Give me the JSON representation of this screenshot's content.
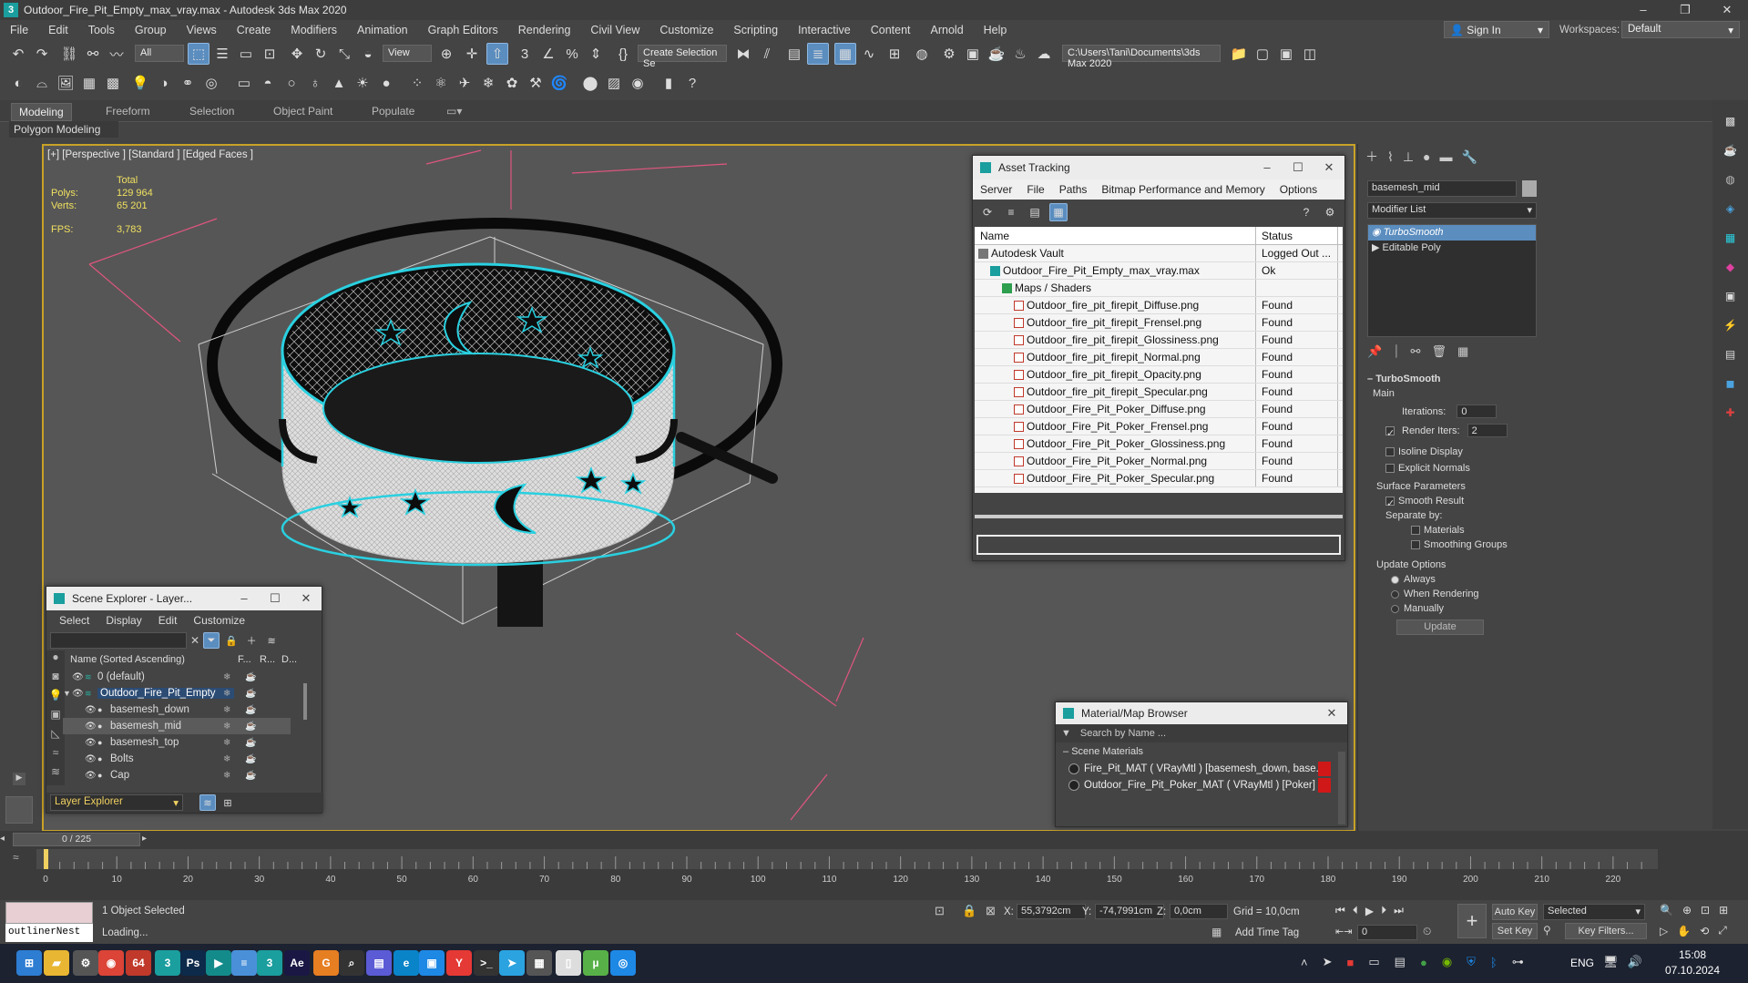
{
  "app": {
    "icon_label": "3",
    "title": "Outdoor_Fire_Pit_Empty_max_vray.max - Autodesk 3ds Max 2020",
    "window_buttons": [
      "–",
      "❐",
      "✕"
    ]
  },
  "menu": [
    "File",
    "Edit",
    "Tools",
    "Group",
    "Views",
    "Create",
    "Modifiers",
    "Animation",
    "Graph Editors",
    "Rendering",
    "Civil View",
    "Customize",
    "Scripting",
    "Interactive",
    "Content",
    "Arnold",
    "Help"
  ],
  "signin": {
    "label": "Sign In"
  },
  "workspaces": {
    "label": "Workspaces:",
    "value": "Default"
  },
  "toolbar": {
    "selection_filter": "All",
    "view_dropdown": "View",
    "create_selection_set": "Create Selection Se",
    "project_path": "C:\\Users\\Tani\\Documents\\3ds Max 2020"
  },
  "ribbon": {
    "tabs": [
      "Modeling",
      "Freeform",
      "Selection",
      "Object Paint",
      "Populate"
    ],
    "sub_label": "Polygon Modeling"
  },
  "viewport": {
    "label": "[+] [Perspective ] [Standard ] [Edged Faces ]",
    "stats": {
      "total_label": "Total",
      "polys_label": "Polys:",
      "polys_value": "129 964",
      "verts_label": "Verts:",
      "verts_value": "65 201",
      "fps_label": "FPS:",
      "fps_value": "3,783"
    }
  },
  "asset_tracking": {
    "title": "Asset Tracking",
    "menu": [
      "Server",
      "File",
      "Paths",
      "Bitmap Performance and Memory",
      "Options"
    ],
    "columns": [
      "Name",
      "Status"
    ],
    "rows": [
      {
        "name": "Autodesk Vault",
        "status": "Logged Out ...",
        "indent": 0,
        "icon": "vault-icon"
      },
      {
        "name": "Outdoor_Fire_Pit_Empty_max_vray.max",
        "status": "Ok",
        "indent": 1,
        "icon": "max-file-icon"
      },
      {
        "name": "Maps / Shaders",
        "status": "",
        "indent": 2,
        "icon": "maps-icon"
      },
      {
        "name": "Outdoor_fire_pit_firepit_Diffuse.png",
        "status": "Found",
        "indent": 3,
        "icon": "png-icon"
      },
      {
        "name": "Outdoor_fire_pit_firepit_Frensel.png",
        "status": "Found",
        "indent": 3,
        "icon": "png-icon"
      },
      {
        "name": "Outdoor_fire_pit_firepit_Glossiness.png",
        "status": "Found",
        "indent": 3,
        "icon": "png-icon"
      },
      {
        "name": "Outdoor_fire_pit_firepit_Normal.png",
        "status": "Found",
        "indent": 3,
        "icon": "png-icon"
      },
      {
        "name": "Outdoor_fire_pit_firepit_Opacity.png",
        "status": "Found",
        "indent": 3,
        "icon": "png-icon"
      },
      {
        "name": "Outdoor_fire_pit_firepit_Specular.png",
        "status": "Found",
        "indent": 3,
        "icon": "png-icon"
      },
      {
        "name": "Outdoor_Fire_Pit_Poker_Diffuse.png",
        "status": "Found",
        "indent": 3,
        "icon": "png-icon"
      },
      {
        "name": "Outdoor_Fire_Pit_Poker_Frensel.png",
        "status": "Found",
        "indent": 3,
        "icon": "png-icon"
      },
      {
        "name": "Outdoor_Fire_Pit_Poker_Glossiness.png",
        "status": "Found",
        "indent": 3,
        "icon": "png-icon"
      },
      {
        "name": "Outdoor_Fire_Pit_Poker_Normal.png",
        "status": "Found",
        "indent": 3,
        "icon": "png-icon"
      },
      {
        "name": "Outdoor_Fire_Pit_Poker_Specular.png",
        "status": "Found",
        "indent": 3,
        "icon": "png-icon"
      }
    ]
  },
  "scene_explorer": {
    "title": "Scene Explorer - Layer...",
    "menu": [
      "Select",
      "Display",
      "Edit",
      "Customize"
    ],
    "columns": [
      "Name (Sorted Ascending)",
      "F...",
      "R...",
      "D..."
    ],
    "rows": [
      {
        "name": "0 (default)",
        "indent": 1,
        "selected": false
      },
      {
        "name": "Outdoor_Fire_Pit_Empty",
        "indent": 1,
        "selected": false,
        "highlight": true
      },
      {
        "name": "basemesh_down",
        "indent": 2,
        "selected": false
      },
      {
        "name": "basemesh_mid",
        "indent": 2,
        "selected": true
      },
      {
        "name": "basemesh_top",
        "indent": 2,
        "selected": false
      },
      {
        "name": "Bolts",
        "indent": 2,
        "selected": false
      },
      {
        "name": "Cap",
        "indent": 2,
        "selected": false
      }
    ],
    "footer": "Layer Explorer"
  },
  "material_browser": {
    "title": "Material/Map Browser",
    "search_placeholder": "Search by Name ...",
    "section": "Scene Materials",
    "items": [
      "Fire_Pit_MAT ( VRayMtl ) [basemesh_down, base...",
      "Outdoor_Fire_Pit_Poker_MAT ( VRayMtl ) [Poker]"
    ]
  },
  "command_panel": {
    "object_name": "basemesh_mid",
    "modifier_list": "Modifier List",
    "stack": [
      "TurboSmooth",
      "Editable Poly"
    ],
    "rollout_title": "TurboSmooth",
    "main_label": "Main",
    "iterations_label": "Iterations:",
    "iterations_value": "0",
    "render_iters_label": "Render Iters:",
    "render_iters_value": "2",
    "isoline_display": "Isoline Display",
    "explicit_normals": "Explicit Normals",
    "surface_params": "Surface Parameters",
    "smooth_result": "Smooth Result",
    "separate_by": "Separate by:",
    "materials": "Materials",
    "smoothing_groups": "Smoothing Groups",
    "update_options": "Update Options",
    "always": "Always",
    "when_rendering": "When Rendering",
    "manually": "Manually",
    "update_button": "Update"
  },
  "timeline": {
    "frame_label": "0 / 225",
    "ticks": [
      "0",
      "10",
      "20",
      "30",
      "40",
      "50",
      "60",
      "70",
      "80",
      "90",
      "100",
      "110",
      "120",
      "130",
      "140",
      "150",
      "160",
      "170",
      "180",
      "190",
      "200",
      "210",
      "220"
    ]
  },
  "status": {
    "selected": "1 Object Selected",
    "loading": "Loading...",
    "listener": "outlinerNest",
    "x_label": "X:",
    "x_value": "55,3792cm",
    "y_label": "Y:",
    "y_value": "-74,7991cm",
    "z_label": "Z:",
    "z_value": "0,0cm",
    "grid": "Grid = 10,0cm",
    "add_time_tag": "Add Time Tag",
    "auto_key": "Auto Key",
    "set_key": "Set Key",
    "selected_dropdown": "Selected",
    "key_filters": "Key Filters...",
    "frame_value": "0"
  },
  "taskbar": {
    "lang": "ENG",
    "time": "15:08",
    "date": "07.10.2024",
    "apps": [
      {
        "name": "start-icon",
        "label": "⊞",
        "color": "#2d7dd2"
      },
      {
        "name": "explorer-icon",
        "label": "▰",
        "color": "#e8b632"
      },
      {
        "name": "settings-icon",
        "label": "⚙",
        "color": "#555"
      },
      {
        "name": "chrome-icon",
        "label": "◉",
        "color": "#db4437"
      },
      {
        "name": "app-64-icon",
        "label": "64",
        "color": "#c0392b"
      },
      {
        "name": "3dsmax-icon",
        "label": "3",
        "color": "#1a9e9e"
      },
      {
        "name": "photoshop-icon",
        "label": "Ps",
        "color": "#0d2a4a"
      },
      {
        "name": "teal-app-icon",
        "label": "▶",
        "color": "#138b8b"
      },
      {
        "name": "notepad-icon",
        "label": "≡",
        "color": "#4a90d9"
      },
      {
        "name": "3dsmax-active-icon",
        "label": "3",
        "color": "#1a9e9e"
      },
      {
        "name": "aftereffects-icon",
        "label": "Ae",
        "color": "#1a1744"
      },
      {
        "name": "g-app-icon",
        "label": "G",
        "color": "#e67e22"
      },
      {
        "name": "search-app-icon",
        "label": "⌕",
        "color": "#333"
      },
      {
        "name": "storage-icon",
        "label": "▤",
        "color": "#5b5bd6"
      },
      {
        "name": "edge-icon",
        "label": "e",
        "color": "#0a84c9"
      },
      {
        "name": "blue-app-icon",
        "label": "▣",
        "color": "#1e88e5"
      },
      {
        "name": "yandex-icon",
        "label": "Y",
        "color": "#e53935"
      },
      {
        "name": "terminal-icon",
        "label": ">_",
        "color": "#333"
      },
      {
        "name": "telegram-icon",
        "label": "➤",
        "color": "#2aa3e0"
      },
      {
        "name": "calculator-icon",
        "label": "▦",
        "color": "#555"
      },
      {
        "name": "document-icon",
        "label": "▯",
        "color": "#ddd"
      },
      {
        "name": "torrent-icon",
        "label": "µ",
        "color": "#58b148"
      },
      {
        "name": "screenshot-icon",
        "label": "◎",
        "color": "#1e88e5"
      }
    ]
  },
  "colors": {
    "accent": "#5b8dbf",
    "viewport_border": "#c9a227",
    "wire": "#ffffff",
    "selection": "#2ad0e0",
    "trajectory": "#e0557f"
  }
}
